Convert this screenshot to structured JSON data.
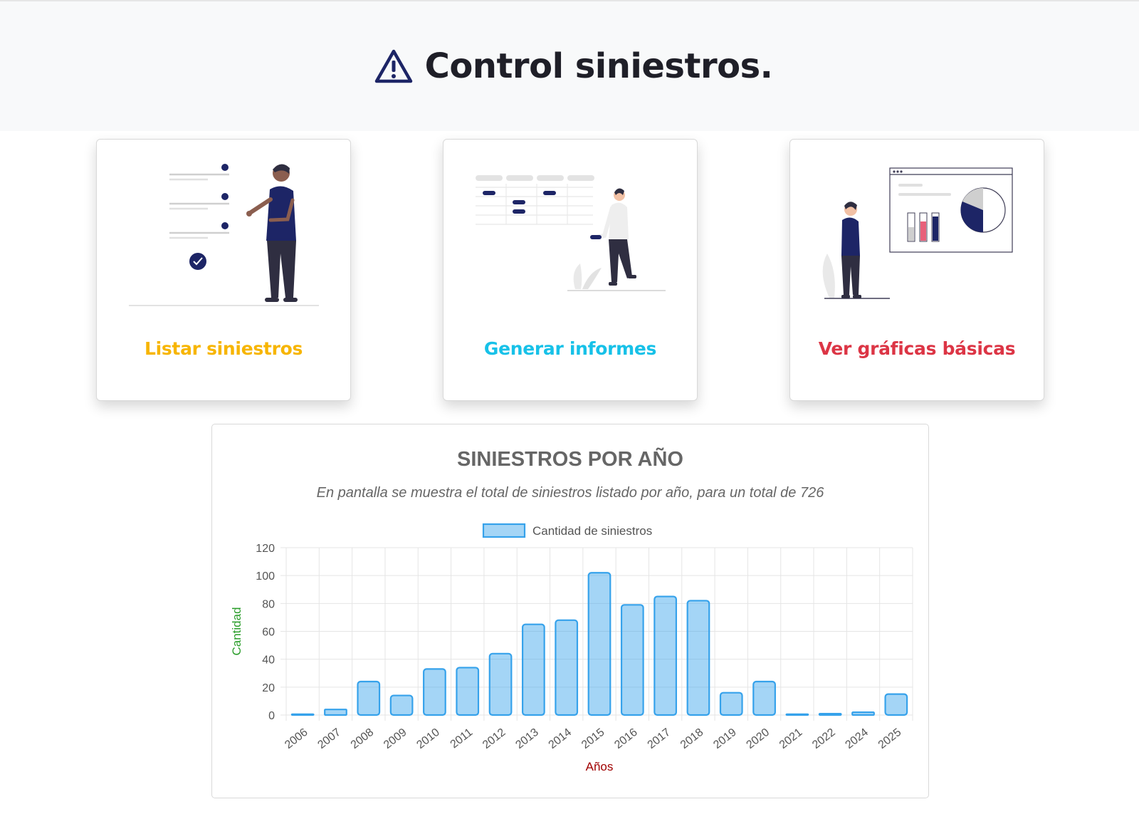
{
  "header": {
    "title": "Control siniestros.",
    "icon": "warning-triangle-icon",
    "icon_color": "#1d2566"
  },
  "cards": [
    {
      "label": "Listar siniestros",
      "color": "#f7b500",
      "illustration": "checklist-person-illustration"
    },
    {
      "label": "Generar informes",
      "color": "#17c1e8",
      "illustration": "table-report-person-illustration"
    },
    {
      "label": "Ver gráficas básicas",
      "color": "#dc3545",
      "illustration": "dashboard-charts-person-illustration"
    }
  ],
  "chart": {
    "title": "SINIESTROS POR AÑO",
    "subtitle": "En pantalla se muestra el total de siniestros listado por año, para un total de 726"
  },
  "chart_data": {
    "type": "bar",
    "categories": [
      "2006",
      "2007",
      "2008",
      "2009",
      "2010",
      "2011",
      "2012",
      "2013",
      "2014",
      "2015",
      "2016",
      "2017",
      "2018",
      "2019",
      "2020",
      "2021",
      "2022",
      "2024",
      "2025"
    ],
    "series": [
      {
        "name": "Cantidad de siniestros",
        "values": [
          0,
          4,
          24,
          14,
          33,
          34,
          44,
          65,
          68,
          102,
          79,
          85,
          82,
          16,
          24,
          0,
          1,
          2,
          15
        ]
      }
    ],
    "title": "SINIESTROS POR AÑO",
    "xlabel": "Años",
    "ylabel": "Cantidad",
    "ylim": [
      0,
      120
    ],
    "yticks": [
      0,
      20,
      40,
      60,
      80,
      100,
      120
    ],
    "grid": true,
    "legend_position": "top",
    "colors": {
      "bar_fill": "rgba(54,162,235,0.45)",
      "bar_border": "#36a2eb",
      "xlabel": "#a00000",
      "ylabel": "#2a9d2a",
      "tick": "#555555",
      "grid": "#e5e5e5"
    }
  }
}
